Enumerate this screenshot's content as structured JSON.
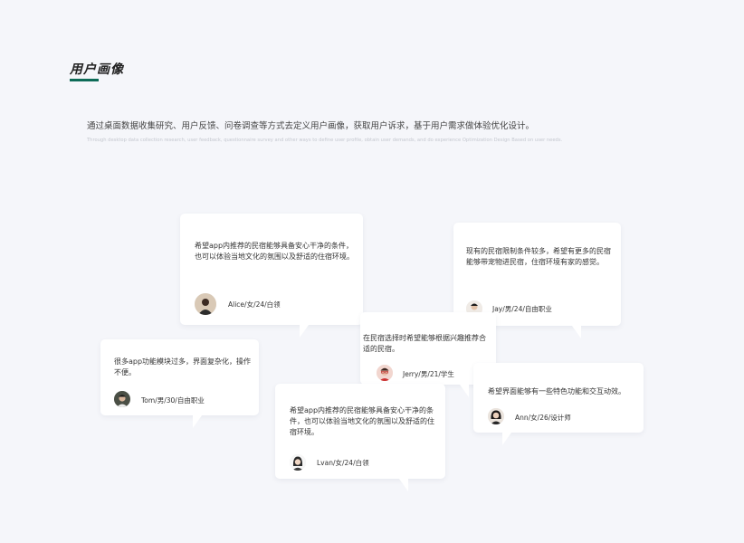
{
  "header": {
    "title": "用户画像",
    "description_cn": "通过桌面数据收集研究、用户反馈、问卷调查等方式去定义用户画像，获取用户诉求，基于用户需求做体验优化设计。",
    "description_en": "Through desktop data collection research, user feedback, questionnaire survey and other ways to define user profile, obtain user demands, and do experience Optimization Design Based on user needs."
  },
  "colors": {
    "background": "#f5f6fa",
    "accent": "#0d6b57",
    "card": "#ffffff"
  },
  "personas": [
    {
      "quote": "希望app内推荐的民宿能够具备安心干净的条件，也可以体验当地文化的氛围以及舒适的住宿环境。",
      "user": "Alice/女/24/白领",
      "avatar_icon": "female-avatar-icon"
    },
    {
      "quote": "现有的民宿限制条件较多，希望有更多的民宿能够带宠物进民宿，住宿环境有家的感觉。",
      "user": "Jay/男/24/自由职业",
      "avatar_icon": "male-avatar-icon"
    },
    {
      "quote": "在民宿选择时希望能够根据兴趣推荐合适的民宿。",
      "user": "Jerry/男/21/学生",
      "avatar_icon": "male-avatar-icon"
    },
    {
      "quote": "很多app功能模块过多，界面复杂化，操作不便。",
      "user": "Tom/男/30/自由职业",
      "avatar_icon": "male-avatar-icon"
    },
    {
      "quote": "希望界面能够有一些特色功能和交互动效。",
      "user": "Ann/女/26/设计师",
      "avatar_icon": "female-avatar-icon"
    },
    {
      "quote": "希望app内推荐的民宿能够具备安心干净的条件，也可以体验当地文化的氛围以及舒适的住宿环境。",
      "user": "Lvan/女/24/白领",
      "avatar_icon": "female-avatar-icon"
    }
  ]
}
